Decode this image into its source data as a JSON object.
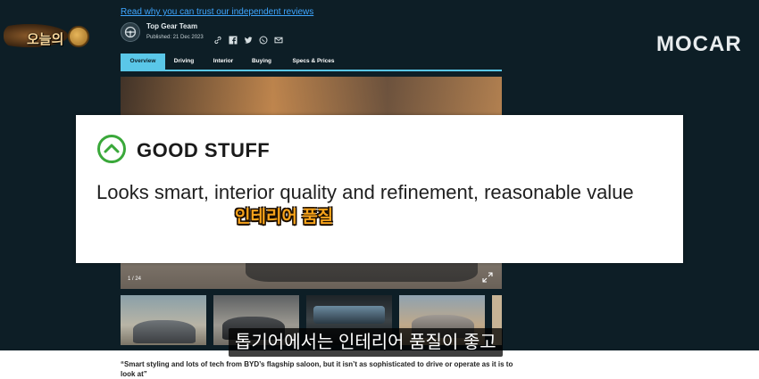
{
  "article": {
    "trust_link": "Read why you can trust our independent reviews",
    "author": "Top Gear Team",
    "published": "Published: 21 Dec 2023",
    "share_icons": [
      "link-icon",
      "facebook-icon",
      "twitter-icon",
      "whatsapp-icon",
      "email-icon"
    ],
    "tabs": [
      {
        "label": "Overview",
        "active": true
      },
      {
        "label": "Driving",
        "active": false
      },
      {
        "label": "Interior",
        "active": false
      },
      {
        "label": "Buying",
        "active": false
      },
      {
        "label": "Specs & Prices",
        "active": false
      }
    ],
    "gallery_counter": "1 / 24",
    "quote": "“Smart styling and lots of tech from BYD’s flagship saloon, but it isn’t as sophisticated to drive or operate as it is to look at”"
  },
  "callout": {
    "heading": "GOOD STUFF",
    "body": "Looks smart, interior quality and refinement, reasonable value",
    "icon": "check-circle-icon",
    "accent": "#3aa83a"
  },
  "overlay": {
    "korean_caption": "인테리어 품질",
    "subtitle": "톱기어에서는 인테리어 품질이 좋고"
  },
  "watermarks": {
    "channel_logo_text": "오늘의",
    "brand_logo_text": "MOCAR"
  },
  "colors": {
    "background": "#0d1e26",
    "tab_active": "#5ac7e8",
    "link": "#3ea6ff",
    "caption_orange": "#f7a31b"
  }
}
